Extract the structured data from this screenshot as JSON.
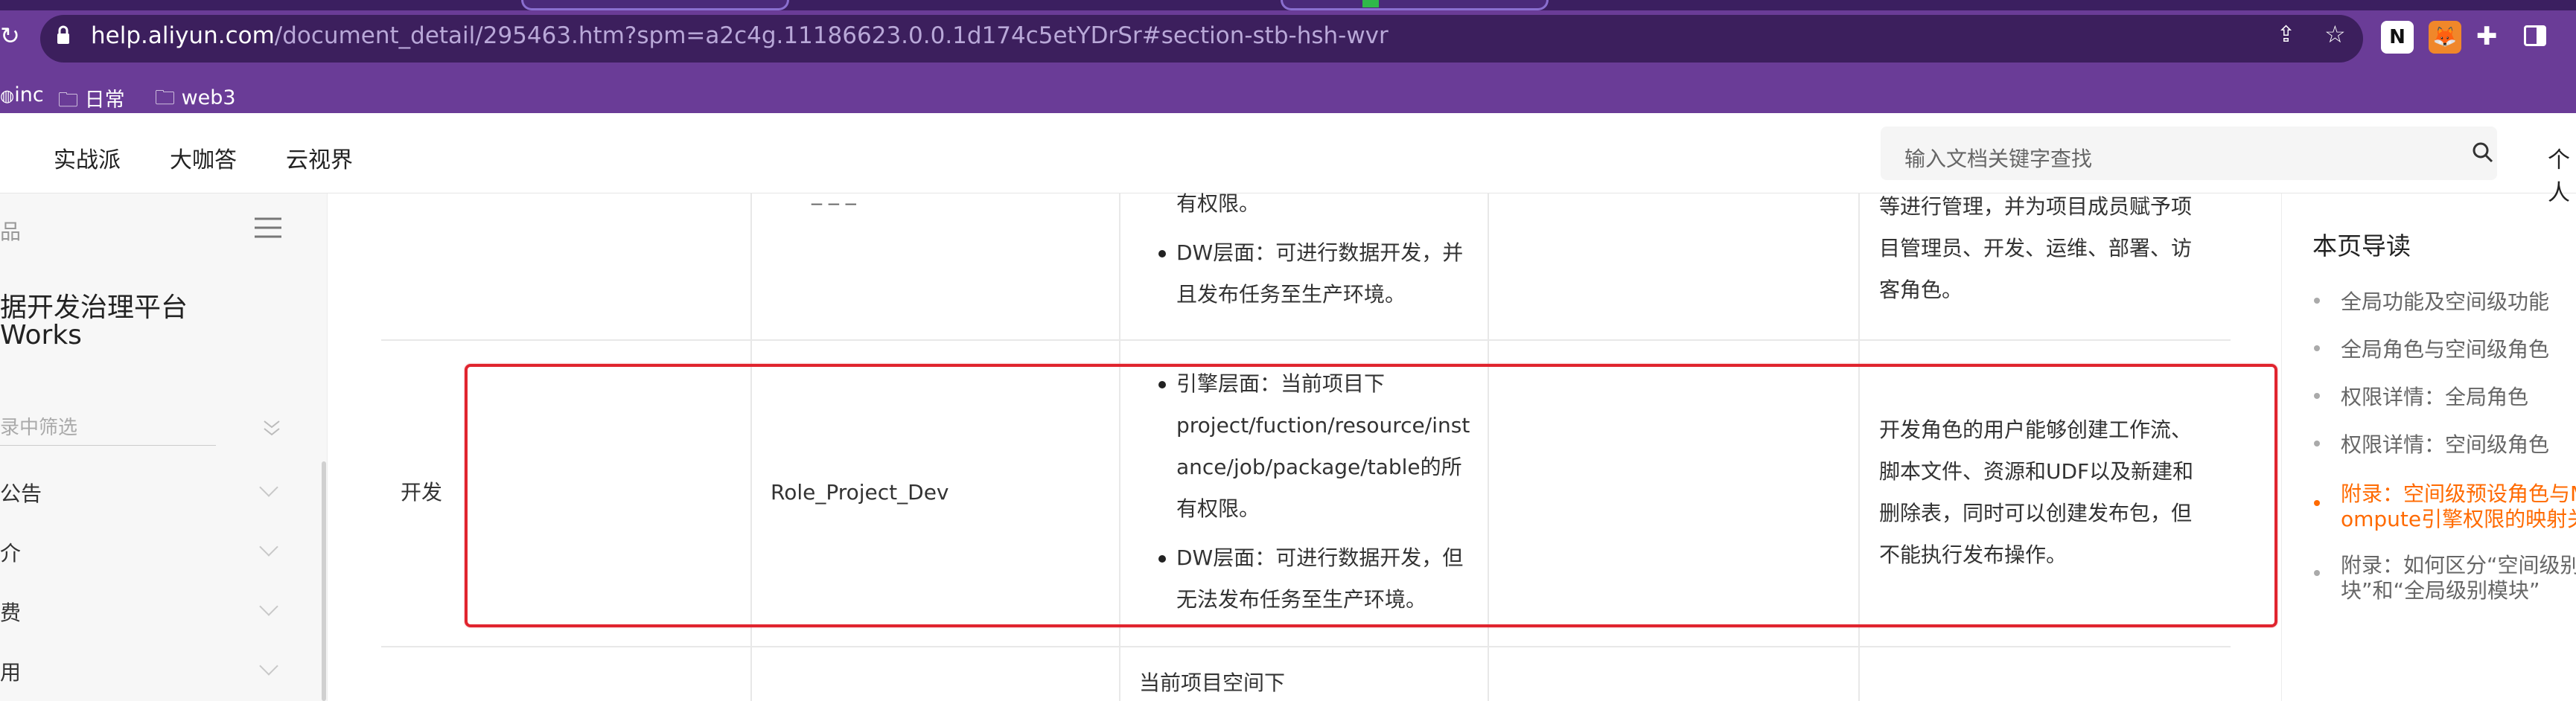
{
  "browser": {
    "url_host": "help.aliyun.com",
    "url_path": "/document_detail/295463.htm?spm=a2c4g.11186623.0.0.1d174c5etYDrSr#section-stb-hsh-wvr",
    "bookmarks": [
      "inc",
      "日常",
      "web3"
    ]
  },
  "site_nav": {
    "links": [
      "实战派",
      "大咖答",
      "云视界"
    ],
    "search_placeholder": "输入文档关键字查找",
    "right_cut_label": "个人"
  },
  "sidebar": {
    "top_label": "品",
    "product_title_line1": "据开发治理平台",
    "product_title_line2": "Works",
    "filter_placeholder": "录中筛选",
    "items": [
      "公告",
      "介",
      "费",
      "用"
    ]
  },
  "table": {
    "row_prev": {
      "col2_partial": "_ _ _",
      "col3_lines": [
        "有权限。"
      ],
      "col3_bullet2": [
        "DW层面：可进行数据开发，并",
        "且发布任务至生产环境。"
      ],
      "col5_lines": [
        "等进行管理，并为项目成员赋予项",
        "目管理员、开发、运维、部署、访",
        "客角色。"
      ]
    },
    "row_dev": {
      "role_cn": "开发",
      "role_code": "Role_Project_Dev",
      "bullet1": [
        "引擎层面：当前项目下",
        "project/fuction/resource/inst",
        "ance/job/package/table的所",
        "有权限。"
      ],
      "bullet2": [
        "DW层面：可进行数据开发，但",
        "无法发布任务至生产环境。"
      ],
      "desc": [
        "开发角色的用户能够创建工作流、",
        "脚本文件、资源和UDF以及新建和",
        "删除表，同时可以创建发布包，但",
        "不能执行发布操作。"
      ]
    },
    "row_next": {
      "col3_line": "当前项目空间下"
    }
  },
  "toc": {
    "title": "本页导读",
    "items": [
      {
        "label": "全局功能及空间级功能",
        "active": false
      },
      {
        "label": "全局角色与空间级角色",
        "active": false
      },
      {
        "label": "权限详情：全局角色",
        "active": false
      },
      {
        "label": "权限详情：空间级角色",
        "active": false
      },
      {
        "label_line1": "附录：空间级预设角色与M",
        "label_line2": "ompute引擎权限的映射关",
        "active": true
      },
      {
        "label_line1": "附录：如何区分“空间级别",
        "label_line2": "块”和“全局级别模块”",
        "active": false
      }
    ]
  },
  "colors": {
    "browser_purple": "#6a3c97",
    "highlight_red": "#e0242e",
    "toc_active": "#ff6a00"
  }
}
